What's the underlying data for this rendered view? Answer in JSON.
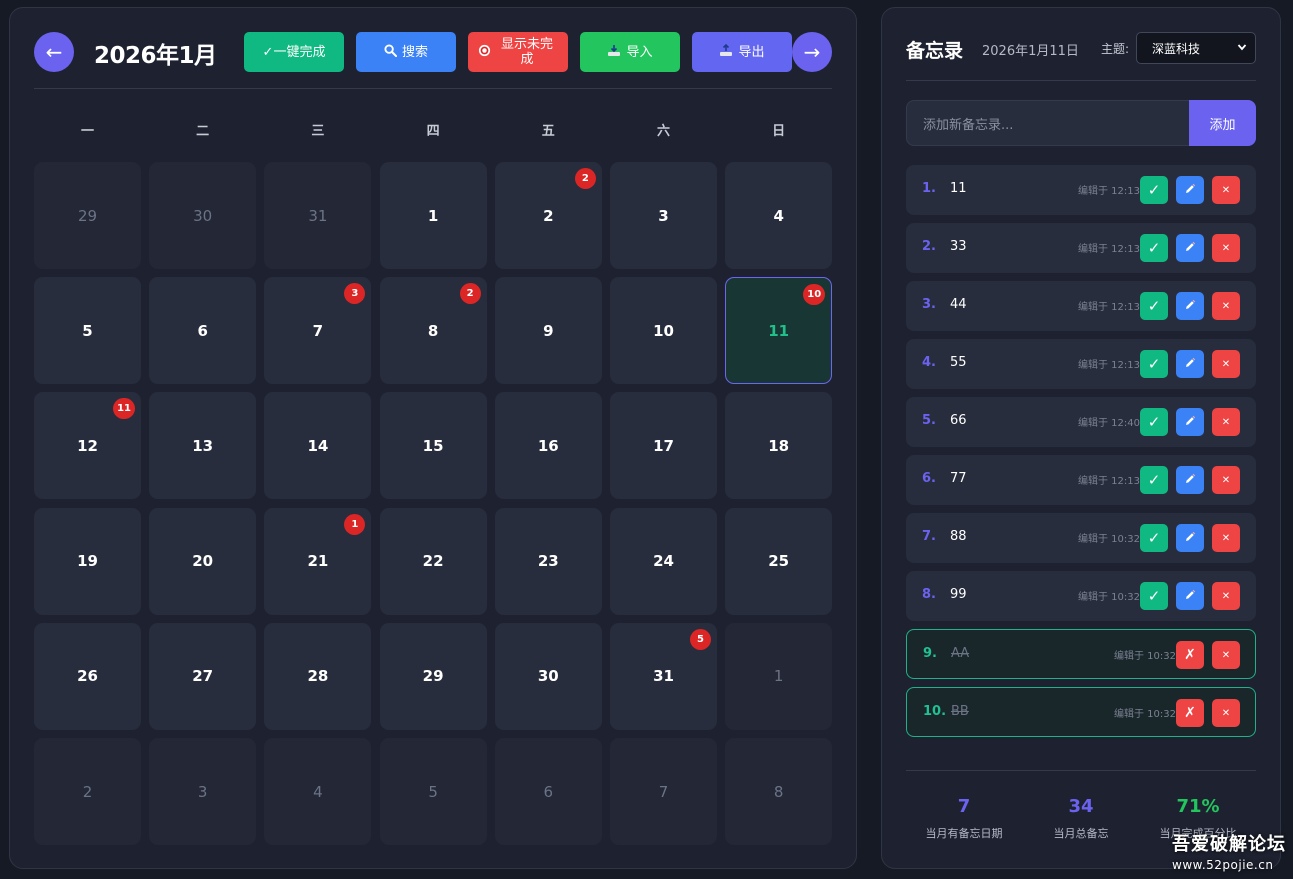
{
  "calendar": {
    "title": "2026年1月",
    "nav_prev": "←",
    "nav_next": "→",
    "toolbar": {
      "complete": "✓一键完成",
      "search": "搜索",
      "unfinished": "显示未完成",
      "import": "导入",
      "export": "导出"
    },
    "weekdays": [
      "一",
      "二",
      "三",
      "四",
      "五",
      "六",
      "日"
    ],
    "days": [
      {
        "label": "29",
        "other": true,
        "badge": ""
      },
      {
        "label": "30",
        "other": true,
        "badge": ""
      },
      {
        "label": "31",
        "other": true,
        "badge": ""
      },
      {
        "label": "1",
        "other": false,
        "badge": ""
      },
      {
        "label": "2",
        "other": false,
        "badge": "2"
      },
      {
        "label": "3",
        "other": false,
        "badge": ""
      },
      {
        "label": "4",
        "other": false,
        "badge": ""
      },
      {
        "label": "5",
        "other": false,
        "badge": ""
      },
      {
        "label": "6",
        "other": false,
        "badge": ""
      },
      {
        "label": "7",
        "other": false,
        "badge": "3"
      },
      {
        "label": "8",
        "other": false,
        "badge": "2"
      },
      {
        "label": "9",
        "other": false,
        "badge": ""
      },
      {
        "label": "10",
        "other": false,
        "badge": ""
      },
      {
        "label": "11",
        "other": false,
        "badge": "10",
        "today": true
      },
      {
        "label": "12",
        "other": false,
        "badge": "11"
      },
      {
        "label": "13",
        "other": false,
        "badge": ""
      },
      {
        "label": "14",
        "other": false,
        "badge": ""
      },
      {
        "label": "15",
        "other": false,
        "badge": ""
      },
      {
        "label": "16",
        "other": false,
        "badge": ""
      },
      {
        "label": "17",
        "other": false,
        "badge": ""
      },
      {
        "label": "18",
        "other": false,
        "badge": ""
      },
      {
        "label": "19",
        "other": false,
        "badge": ""
      },
      {
        "label": "20",
        "other": false,
        "badge": ""
      },
      {
        "label": "21",
        "other": false,
        "badge": "1"
      },
      {
        "label": "22",
        "other": false,
        "badge": ""
      },
      {
        "label": "23",
        "other": false,
        "badge": ""
      },
      {
        "label": "24",
        "other": false,
        "badge": ""
      },
      {
        "label": "25",
        "other": false,
        "badge": ""
      },
      {
        "label": "26",
        "other": false,
        "badge": ""
      },
      {
        "label": "27",
        "other": false,
        "badge": ""
      },
      {
        "label": "28",
        "other": false,
        "badge": ""
      },
      {
        "label": "29",
        "other": false,
        "badge": ""
      },
      {
        "label": "30",
        "other": false,
        "badge": ""
      },
      {
        "label": "31",
        "other": false,
        "badge": "5"
      },
      {
        "label": "1",
        "other": true,
        "badge": ""
      },
      {
        "label": "2",
        "other": true,
        "badge": ""
      },
      {
        "label": "3",
        "other": true,
        "badge": ""
      },
      {
        "label": "4",
        "other": true,
        "badge": ""
      },
      {
        "label": "5",
        "other": true,
        "badge": ""
      },
      {
        "label": "6",
        "other": true,
        "badge": ""
      },
      {
        "label": "7",
        "other": true,
        "badge": ""
      },
      {
        "label": "8",
        "other": true,
        "badge": ""
      }
    ]
  },
  "memo": {
    "title": "备忘录",
    "date": "2026年1月11日",
    "theme_label": "主题:",
    "theme_value": "深蓝科技",
    "input_placeholder": "添加新备忘录...",
    "add_label": "添加",
    "items": [
      {
        "num": "1.",
        "text": "11",
        "time": "编辑于 12:13",
        "done": false
      },
      {
        "num": "2.",
        "text": "33",
        "time": "编辑于 12:13",
        "done": false
      },
      {
        "num": "3.",
        "text": "44",
        "time": "编辑于 12:13",
        "done": false
      },
      {
        "num": "4.",
        "text": "55",
        "time": "编辑于 12:13",
        "done": false
      },
      {
        "num": "5.",
        "text": "66",
        "time": "编辑于 12:40",
        "done": false
      },
      {
        "num": "6.",
        "text": "77",
        "time": "编辑于 12:13",
        "done": false
      },
      {
        "num": "7.",
        "text": "88",
        "time": "编辑于 10:32",
        "done": false
      },
      {
        "num": "8.",
        "text": "99",
        "time": "编辑于 10:32",
        "done": false
      },
      {
        "num": "9.",
        "text": "AA",
        "time": "编辑于 10:32",
        "done": true
      },
      {
        "num": "10.",
        "text": "BB",
        "time": "编辑于 10:32",
        "done": true
      }
    ],
    "stats": [
      {
        "value": "7",
        "label": "当月有备忘日期",
        "color": "#6b63f0"
      },
      {
        "value": "34",
        "label": "当月总备忘",
        "color": "#6b63f0"
      },
      {
        "value": "71%",
        "label": "当月完成百分比",
        "color": "#22c55e"
      }
    ]
  },
  "watermark": {
    "line1": "吾爱破解论坛",
    "line2": "www.52pojie.cn"
  },
  "colors": {
    "accent": "#6b63f0",
    "badge": "#dc2626",
    "today_text": "#21c08b"
  }
}
